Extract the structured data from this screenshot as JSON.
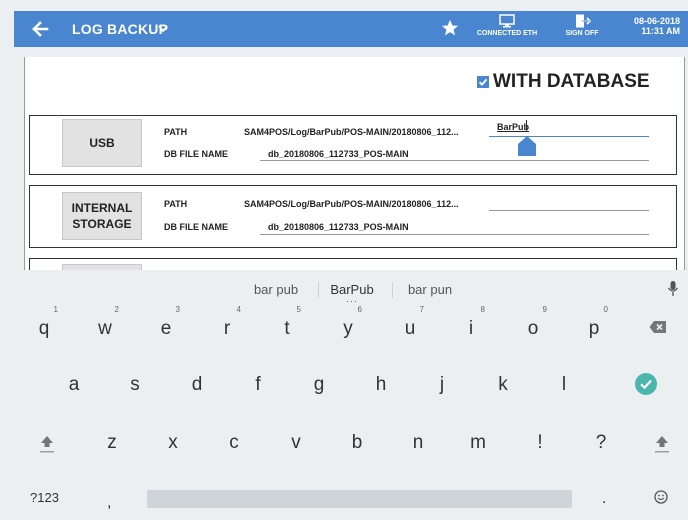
{
  "header": {
    "title": "LOG BACKUP",
    "connected_label": "CONNECTED ETH",
    "signoff_label": "SIGN OFF",
    "date": "08-06-2018",
    "time": "11:31 AM",
    "accent_color": "#4a86cf"
  },
  "with_database": {
    "label": "WITH DATABASE",
    "checked": true
  },
  "usb": {
    "button_label": "USB",
    "path_label": "PATH",
    "path_value": "SAM4POS/Log/BarPub/POS-MAIN/20180806_112...",
    "path_input_value": "BarPub",
    "db_label": "DB FILE NAME",
    "db_value": "db_20180806_112733_POS-MAIN"
  },
  "internal": {
    "button_label_1": "INTERNAL",
    "button_label_2": "STORAGE",
    "path_label": "PATH",
    "path_value": "SAM4POS/Log/BarPub/POS-MAIN/20180806_112...",
    "db_label": "DB FILE NAME",
    "db_value": "db_20180806_112733_POS-MAIN"
  },
  "keyboard": {
    "suggestions": [
      "bar pub",
      "BarPub",
      "bar pun"
    ],
    "row1": [
      {
        "k": "q",
        "n": "1"
      },
      {
        "k": "w",
        "n": "2"
      },
      {
        "k": "e",
        "n": "3"
      },
      {
        "k": "r",
        "n": "4"
      },
      {
        "k": "t",
        "n": "5"
      },
      {
        "k": "y",
        "n": "6"
      },
      {
        "k": "u",
        "n": "7"
      },
      {
        "k": "i",
        "n": "8"
      },
      {
        "k": "o",
        "n": "9"
      },
      {
        "k": "p",
        "n": "0"
      }
    ],
    "row2": [
      "a",
      "s",
      "d",
      "f",
      "g",
      "h",
      "j",
      "k",
      "l"
    ],
    "row3": [
      "z",
      "x",
      "c",
      "v",
      "b",
      "n",
      "m",
      "!",
      "?"
    ],
    "symbols_label": "?123",
    "comma": ",",
    "period": ".",
    "icons": {
      "backspace": "backspace-icon",
      "done": "check-icon",
      "shift": "shift-icon",
      "emoji": "emoji-icon",
      "mic": "mic-icon"
    },
    "done_color": "#4db6ac"
  }
}
